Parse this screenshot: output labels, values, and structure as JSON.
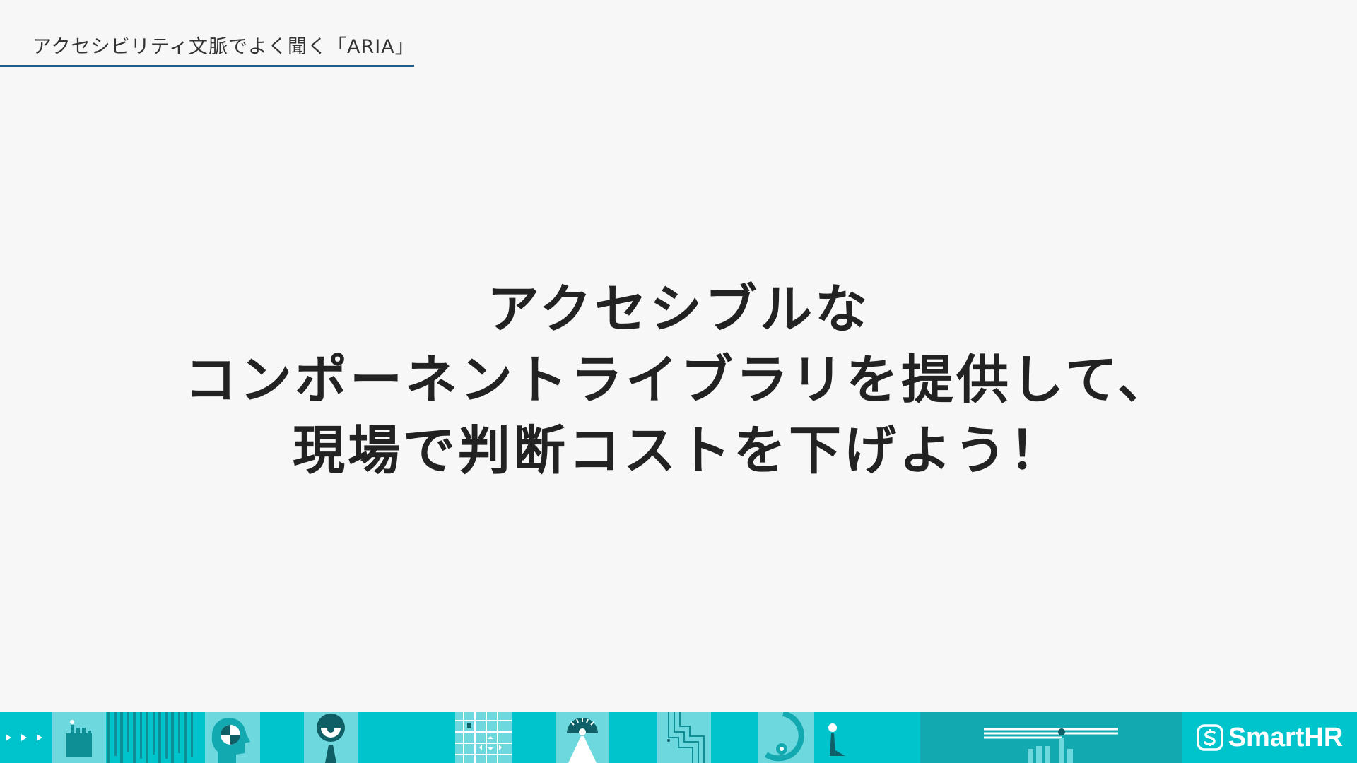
{
  "header": {
    "section_title": "アクセシビリティ文脈でよく聞く「ARIA」"
  },
  "main": {
    "lines": [
      "アクセシブルな",
      "コンポーネントライブラリを提供して、",
      "現場で判断コストを下げよう！"
    ]
  },
  "footer": {
    "logo_text": "SmartHR",
    "colors": {
      "band": "#00c4cc",
      "light": "#6dd9de",
      "dark": "#0e8f96",
      "mid": "#12a9b1"
    },
    "decorations": [
      "play-arrows-icon",
      "hand-icon",
      "barcode-icon",
      "head-profile-icon",
      "eye-figure-icon",
      "keypad-grid-icon",
      "eye-beam-icon",
      "circuit-icon",
      "spiral-figure-icon",
      "slider-hand-icon",
      "smarthr-logo-icon"
    ]
  }
}
